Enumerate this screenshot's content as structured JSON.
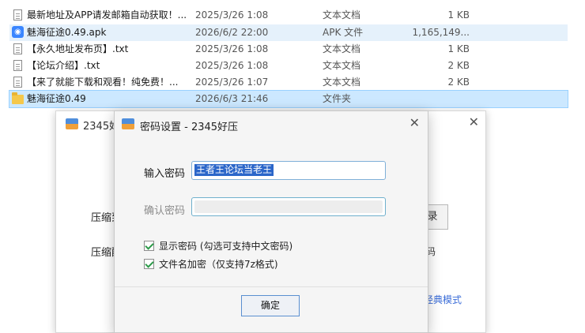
{
  "files": [
    {
      "name": "最新地址及APP请发邮箱自动获取！...",
      "date": "2025/3/26 1:08",
      "type": "文本文档",
      "size": "1 KB",
      "icon": "text-file-icon",
      "state": ""
    },
    {
      "name": "魅海征途0.49.apk",
      "date": "2026/6/2 22:00",
      "type": "APK 文件",
      "size": "1,165,149...",
      "icon": "apk-file-icon",
      "state": "hover"
    },
    {
      "name": "【永久地址发布页】.txt",
      "date": "2025/3/26 1:08",
      "type": "文本文档",
      "size": "1 KB",
      "icon": "text-file-icon",
      "state": ""
    },
    {
      "name": "【论坛介绍】.txt",
      "date": "2025/3/26 1:08",
      "type": "文本文档",
      "size": "2 KB",
      "icon": "text-file-icon",
      "state": ""
    },
    {
      "name": "【来了就能下载和观看！纯免费！...",
      "date": "2025/3/26 1:07",
      "type": "文本文档",
      "size": "2 KB",
      "icon": "text-file-icon",
      "state": ""
    },
    {
      "name": "魅海征途0.49",
      "date": "2026/6/3 21:46",
      "type": "文件夹",
      "size": "",
      "icon": "folder-icon",
      "state": "selected"
    }
  ],
  "main_window": {
    "title": "2345好",
    "label_compress_to": "压缩到",
    "label_compress_fmt": "压缩配",
    "browse_button": "录",
    "right_text": "码",
    "classic_mode_link": "经典模式"
  },
  "dialog": {
    "title": "密码设置 - 2345好压",
    "enter_password_label": "输入密码",
    "enter_password_value": "王者王论坛当老王",
    "confirm_password_label": "确认密码",
    "confirm_password_value": "",
    "show_password_label": "显示密码 (勾选可支持中文密码)",
    "show_password_checked": true,
    "encrypt_filenames_label": "文件名加密（仅支持7z格式)",
    "encrypt_filenames_checked": true,
    "ok_button": "确定"
  },
  "colors": {
    "selection_bg": "#cce8ff",
    "hover_bg": "#e5f1fb",
    "text_selection": "#2b66c9",
    "link": "#3b6dd8"
  }
}
